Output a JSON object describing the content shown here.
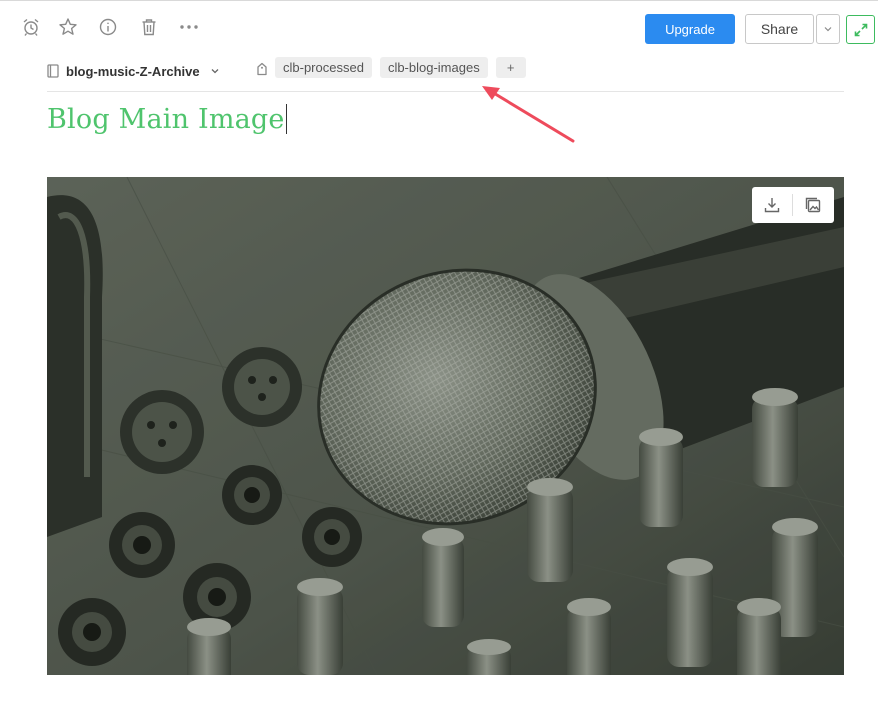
{
  "toolbar": {
    "icons": [
      "alarm-clock-icon",
      "star-icon",
      "info-icon",
      "trash-icon",
      "more-icon"
    ],
    "upgrade_label": "Upgrade",
    "share_label": "Share",
    "accent_green": "#3dbb5e",
    "accent_blue": "#2b8bf0"
  },
  "meta": {
    "notebook": "blog-music-Z-Archive",
    "tags": [
      "clb-processed",
      "clb-blog-images"
    ],
    "add_tag_label": "+"
  },
  "note": {
    "title": "Blog Main Image",
    "title_color": "#4fc46d"
  },
  "annotation": {
    "arrow_color": "#ee4b5c"
  },
  "image": {
    "subject": "microphone on audio mixing console",
    "actions": [
      "download-icon",
      "open-gallery-icon"
    ]
  }
}
